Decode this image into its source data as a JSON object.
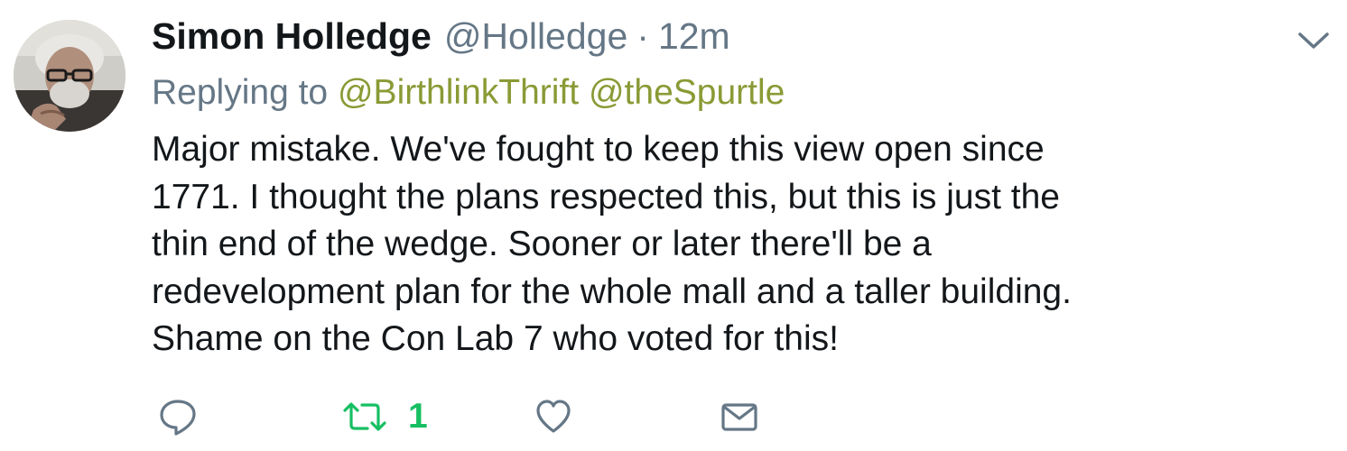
{
  "tweet": {
    "display_name": "Simon Holledge",
    "handle": "@Holledge",
    "separator": "·",
    "timestamp": "12m",
    "replying_prefix": "Replying to",
    "mentions": [
      "@BirthlinkThrift",
      "@theSpurtle"
    ],
    "text_lines": [
      "Major mistake. We've fought to keep this view open since",
      "1771. I thought the plans respected this, but this is just the",
      "thin end of the wedge. Sooner or later there'll be a",
      "redevelopment plan for the whole mall and a taller building.",
      "Shame on the Con Lab 7 who voted for this!"
    ]
  },
  "actions": {
    "reply_icon": "reply-bubble-icon",
    "retweet_icon": "retweet-icon",
    "retweet_count": "1",
    "like_icon": "heart-icon",
    "dm_icon": "envelope-icon"
  },
  "colors": {
    "text": "#14171a",
    "muted": "#657786",
    "mention": "#8a9a35",
    "retweeted": "#17bf63",
    "icon": "#657786"
  }
}
